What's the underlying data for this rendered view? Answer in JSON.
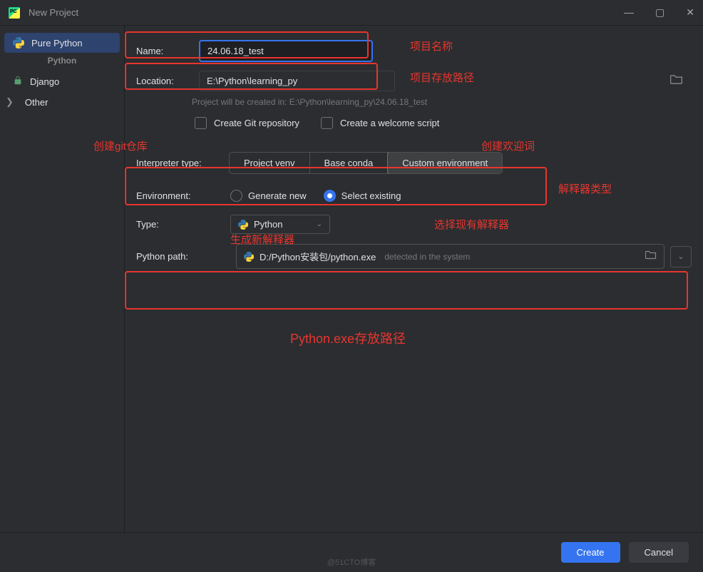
{
  "window": {
    "title": "New Project"
  },
  "sidebar": {
    "heading": "Python",
    "pure_python": "Pure Python",
    "django": "Django",
    "other": "Other"
  },
  "form": {
    "name_label": "Name:",
    "name_value": "24.06.18_test",
    "location_label": "Location:",
    "location_value": "E:\\Python\\learning_py",
    "hint": "Project will be created in: E:\\Python\\learning_py\\24.06.18_test",
    "create_git": "Create Git repository",
    "create_welcome": "Create a welcome script",
    "interpreter_type_label": "Interpreter type:",
    "interpreter_options": {
      "venv": "Project venv",
      "conda": "Base conda",
      "custom": "Custom environment"
    },
    "environment_label": "Environment:",
    "generate_new": "Generate new",
    "select_existing": "Select existing",
    "type_label": "Type:",
    "type_value": "Python",
    "python_path_label": "Python path:",
    "python_path_value": "D:/Python安装包/python.exe",
    "detected": "detected in the system"
  },
  "annotations": {
    "project_name": "项目名称",
    "project_path": "项目存放路径",
    "create_git_repo": "创建git仓库",
    "create_welcome_word": "创建欢迎词",
    "interpreter_type": "解释器类型",
    "select_existing_interpreter": "选择现有解释器",
    "generate_new_interpreter": "生成新解释器",
    "python_exe_path": "Python.exe存放路径"
  },
  "footer": {
    "create": "Create",
    "cancel": "Cancel"
  },
  "watermark": "@51CTO博客"
}
